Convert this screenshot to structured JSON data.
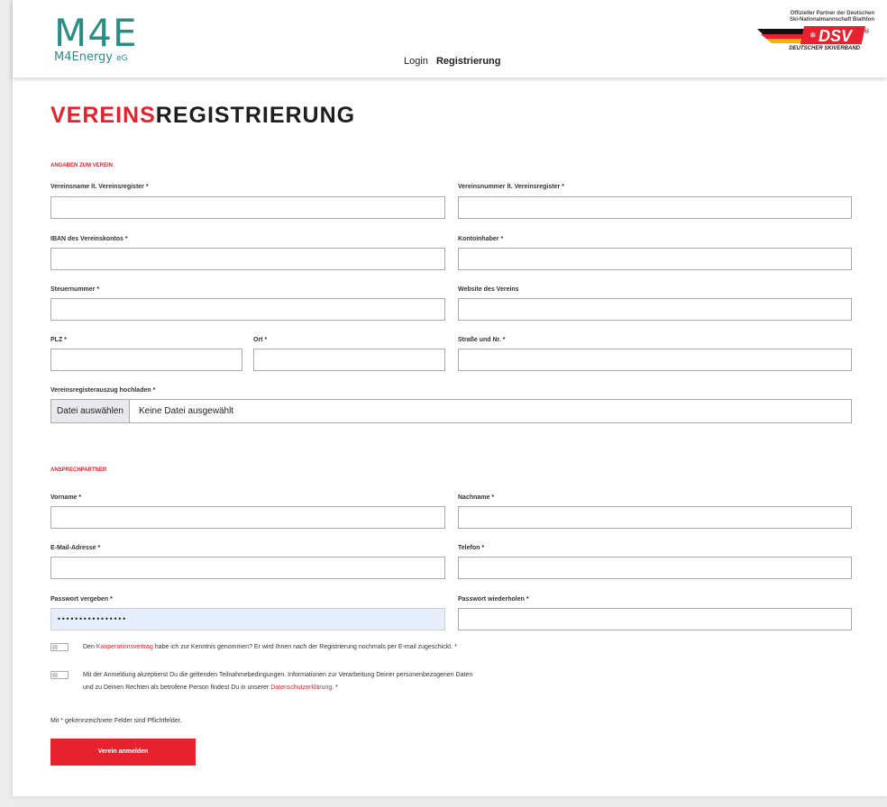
{
  "header": {
    "logo_mark": "M4E",
    "logo_name": "M4Energy",
    "logo_suffix": "eG",
    "nav": {
      "login": "Login",
      "register": "Registrierung"
    },
    "partner_line1": "Offizieller Partner der Deutschen",
    "partner_line2": "Ski-Nationalmannschaft Biathlon",
    "partner_logo_text": "DSV",
    "partner_name": "DEUTSCHER SKIVERBAND"
  },
  "page_title": {
    "red": "VEREINS",
    "dark": "REGISTRIERUNG"
  },
  "club_section": {
    "heading": "ANGABEN ZUM VEREIN",
    "fields": {
      "club_name": {
        "label": "Vereinsname lt. Vereinsregister *",
        "value": ""
      },
      "club_number": {
        "label": "Vereinsnummer lt. Vereinsregister *",
        "value": ""
      },
      "iban": {
        "label": "IBAN des Vereinskontos *",
        "value": ""
      },
      "account_holder": {
        "label": "Kontoinhaber *",
        "value": ""
      },
      "tax_number": {
        "label": "Steuernummer *",
        "value": ""
      },
      "website": {
        "label": "Website des Vereins",
        "value": ""
      },
      "zip": {
        "label": "PLZ *",
        "value": ""
      },
      "city": {
        "label": "Ort *",
        "value": ""
      },
      "street": {
        "label": "Straße und Nr. *",
        "value": ""
      }
    },
    "upload": {
      "label": "Vereinsregisterauszug hochladen *",
      "button": "Datei auswählen",
      "status": "Keine Datei ausgewählt"
    }
  },
  "contact_section": {
    "heading": "ANSPRECHPARTNER",
    "fields": {
      "first_name": {
        "label": "Vorname *",
        "value": ""
      },
      "last_name": {
        "label": "Nachname *",
        "value": ""
      },
      "email": {
        "label": "E-Mail-Adresse *",
        "value": ""
      },
      "phone": {
        "label": "Telefon *",
        "value": ""
      },
      "password": {
        "label": "Passwort vergeben *",
        "value": "••••••••••••••••"
      },
      "password_repeat": {
        "label": "Passwort wiederholen *",
        "value": ""
      }
    }
  },
  "consents": {
    "cooperation": {
      "before": "Den ",
      "link": "Kooperationsvertrag",
      "after": " habe ich zur Kenntnis genommen? Er wird Ihnen nach der Registrierung nochmals per E-mail zugeschickt. *"
    },
    "privacy": {
      "line1": "Mit der Anmeldung akzeptierst Du die geltenden Teilnahmebedingungen. Informationen zur Verarbeitung Deiner personenbezogenen Daten",
      "line2_before": "und zu Deinen Rechten als betrofene Person findest Du in unserer ",
      "link": "Datenschutzerklärung.",
      "line2_after": " *"
    }
  },
  "required_note": "Mit * gekennzeichnete Felder sind Pflichtfelder.",
  "submit_label": "Verein anmelden",
  "colors": {
    "accent": "#e8212e",
    "brand": "#2a8d86"
  }
}
